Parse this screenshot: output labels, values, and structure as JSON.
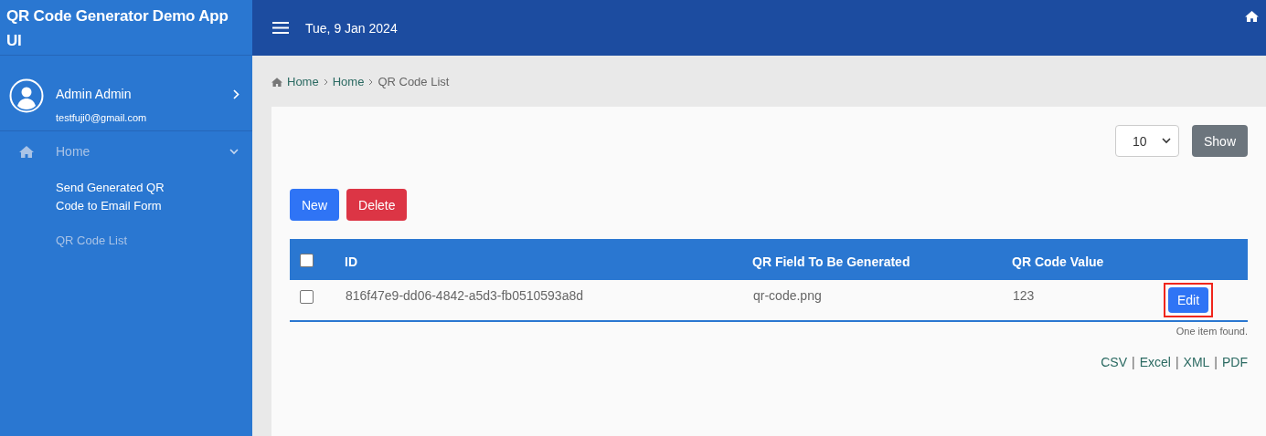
{
  "app": {
    "title": "QR Code Generator Demo App UI"
  },
  "user": {
    "name": "Admin Admin",
    "email": "testfuji0@gmail.com"
  },
  "sidebar": {
    "items": [
      {
        "label": "Home",
        "expanded": true,
        "children": [
          {
            "label": "Send Generated QR Code to Email Form",
            "selected": false
          },
          {
            "label": "QR Code List",
            "selected": true
          }
        ]
      }
    ]
  },
  "topbar": {
    "date": "Tue, 9 Jan 2024"
  },
  "breadcrumb": [
    {
      "label": "Home",
      "kind": "link"
    },
    {
      "label": "Home",
      "kind": "link"
    },
    {
      "label": "QR Code List",
      "kind": "current"
    }
  ],
  "page_size": {
    "value": "10",
    "button": "Show"
  },
  "actions": [
    {
      "label": "New",
      "kind": "primary"
    },
    {
      "label": "Delete",
      "kind": "danger"
    }
  ],
  "table": {
    "select_all": false,
    "columns": [
      "ID",
      "QR Field To Be Generated",
      "QR Code Value"
    ],
    "rows": [
      {
        "checked": false,
        "cells": [
          "816f47e9-dd06-4842-a5d3-fb0510593a8d",
          "qr-code.png",
          "123"
        ],
        "action": {
          "label": "Edit",
          "highlighted": true
        }
      }
    ]
  },
  "summary": "One item found.",
  "exports": [
    "CSV",
    "Excel",
    "XML",
    "PDF"
  ],
  "export_separator": "|"
}
